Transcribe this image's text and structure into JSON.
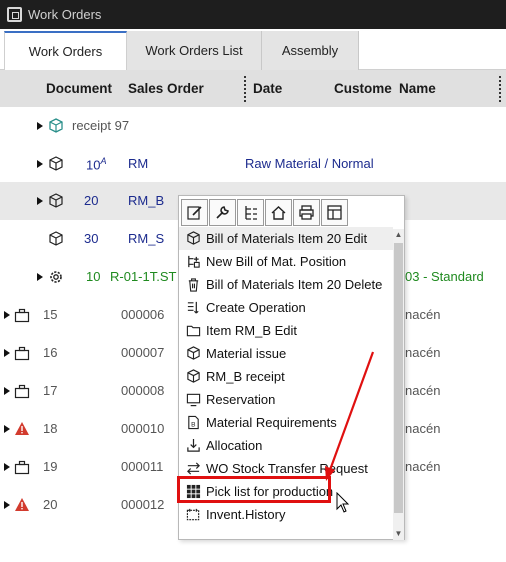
{
  "window": {
    "title": "Work Orders"
  },
  "tabs": [
    {
      "label": "Work Orders",
      "active": true
    },
    {
      "label": "Work Orders List",
      "active": false
    },
    {
      "label": "Assembly",
      "active": false
    }
  ],
  "columns": {
    "document": "Document",
    "sales_order": "Sales Order",
    "date": "Date",
    "customer": "Custome",
    "name": "Name"
  },
  "rows": [
    {
      "doc": "receipt 97",
      "icon": "receipt-icon"
    },
    {
      "doc": "10",
      "doc_sup": "A",
      "so": "RM",
      "name": "Raw Material / Normal",
      "icon": "cube-icon"
    },
    {
      "doc": "20",
      "so": "RM_B",
      "icon": "cube-icon",
      "selected": true
    },
    {
      "doc": "30",
      "so": "RM_S",
      "icon": "cube-icon"
    },
    {
      "doc": "10",
      "so": "R-01-1T.ST",
      "name": "03 - Standard",
      "icon": "gear-icon"
    },
    {
      "doc": "15",
      "so": "000006",
      "name": "nacén",
      "icon": "briefcase-icon"
    },
    {
      "doc": "16",
      "so": "000007",
      "name": "nacén",
      "icon": "briefcase-icon"
    },
    {
      "doc": "17",
      "so": "000008",
      "name": "nacén",
      "icon": "briefcase-icon"
    },
    {
      "doc": "18",
      "so": "000010",
      "name": "nacén",
      "icon": "warning-icon"
    },
    {
      "doc": "19",
      "so": "000011",
      "name": "nacén",
      "icon": "briefcase-icon"
    },
    {
      "doc": "20",
      "so": "000012",
      "name": "nacén",
      "icon": "warning-icon"
    }
  ],
  "context_menu": {
    "toolbar": [
      "edit-icon",
      "wrench-icon",
      "hierarchy-icon",
      "home-icon",
      "print-icon",
      "layout-icon"
    ],
    "items": [
      {
        "label": "Bill of Materials Item 20 Edit",
        "icon": "cube-icon"
      },
      {
        "label": "New Bill of Mat. Position",
        "icon": "new-position-icon"
      },
      {
        "label": "Bill of Materials Item 20 Delete",
        "icon": "trash-icon"
      },
      {
        "label": "Create Operation",
        "icon": "operation-icon"
      },
      {
        "label": "Item RM_B Edit",
        "icon": "folder-icon"
      },
      {
        "label": "Material issue",
        "icon": "cube-icon"
      },
      {
        "label": "RM_B receipt",
        "icon": "cube-icon"
      },
      {
        "label": "Reservation",
        "icon": "monitor-icon"
      },
      {
        "label": "Material Requirements",
        "icon": "document-b-icon"
      },
      {
        "label": "Allocation",
        "icon": "download-icon"
      },
      {
        "label": "WO Stock Transfer Request",
        "icon": "transfer-icon"
      },
      {
        "label": "Pick list for production",
        "icon": "grid-icon",
        "highlighted": true
      },
      {
        "label": "Invent.History",
        "icon": "history-icon"
      }
    ]
  },
  "colors": {
    "accent_blue": "#1c2b8e",
    "green": "#1f8a1f",
    "highlight_red": "#e01010",
    "warning_red": "#d23b2e"
  }
}
